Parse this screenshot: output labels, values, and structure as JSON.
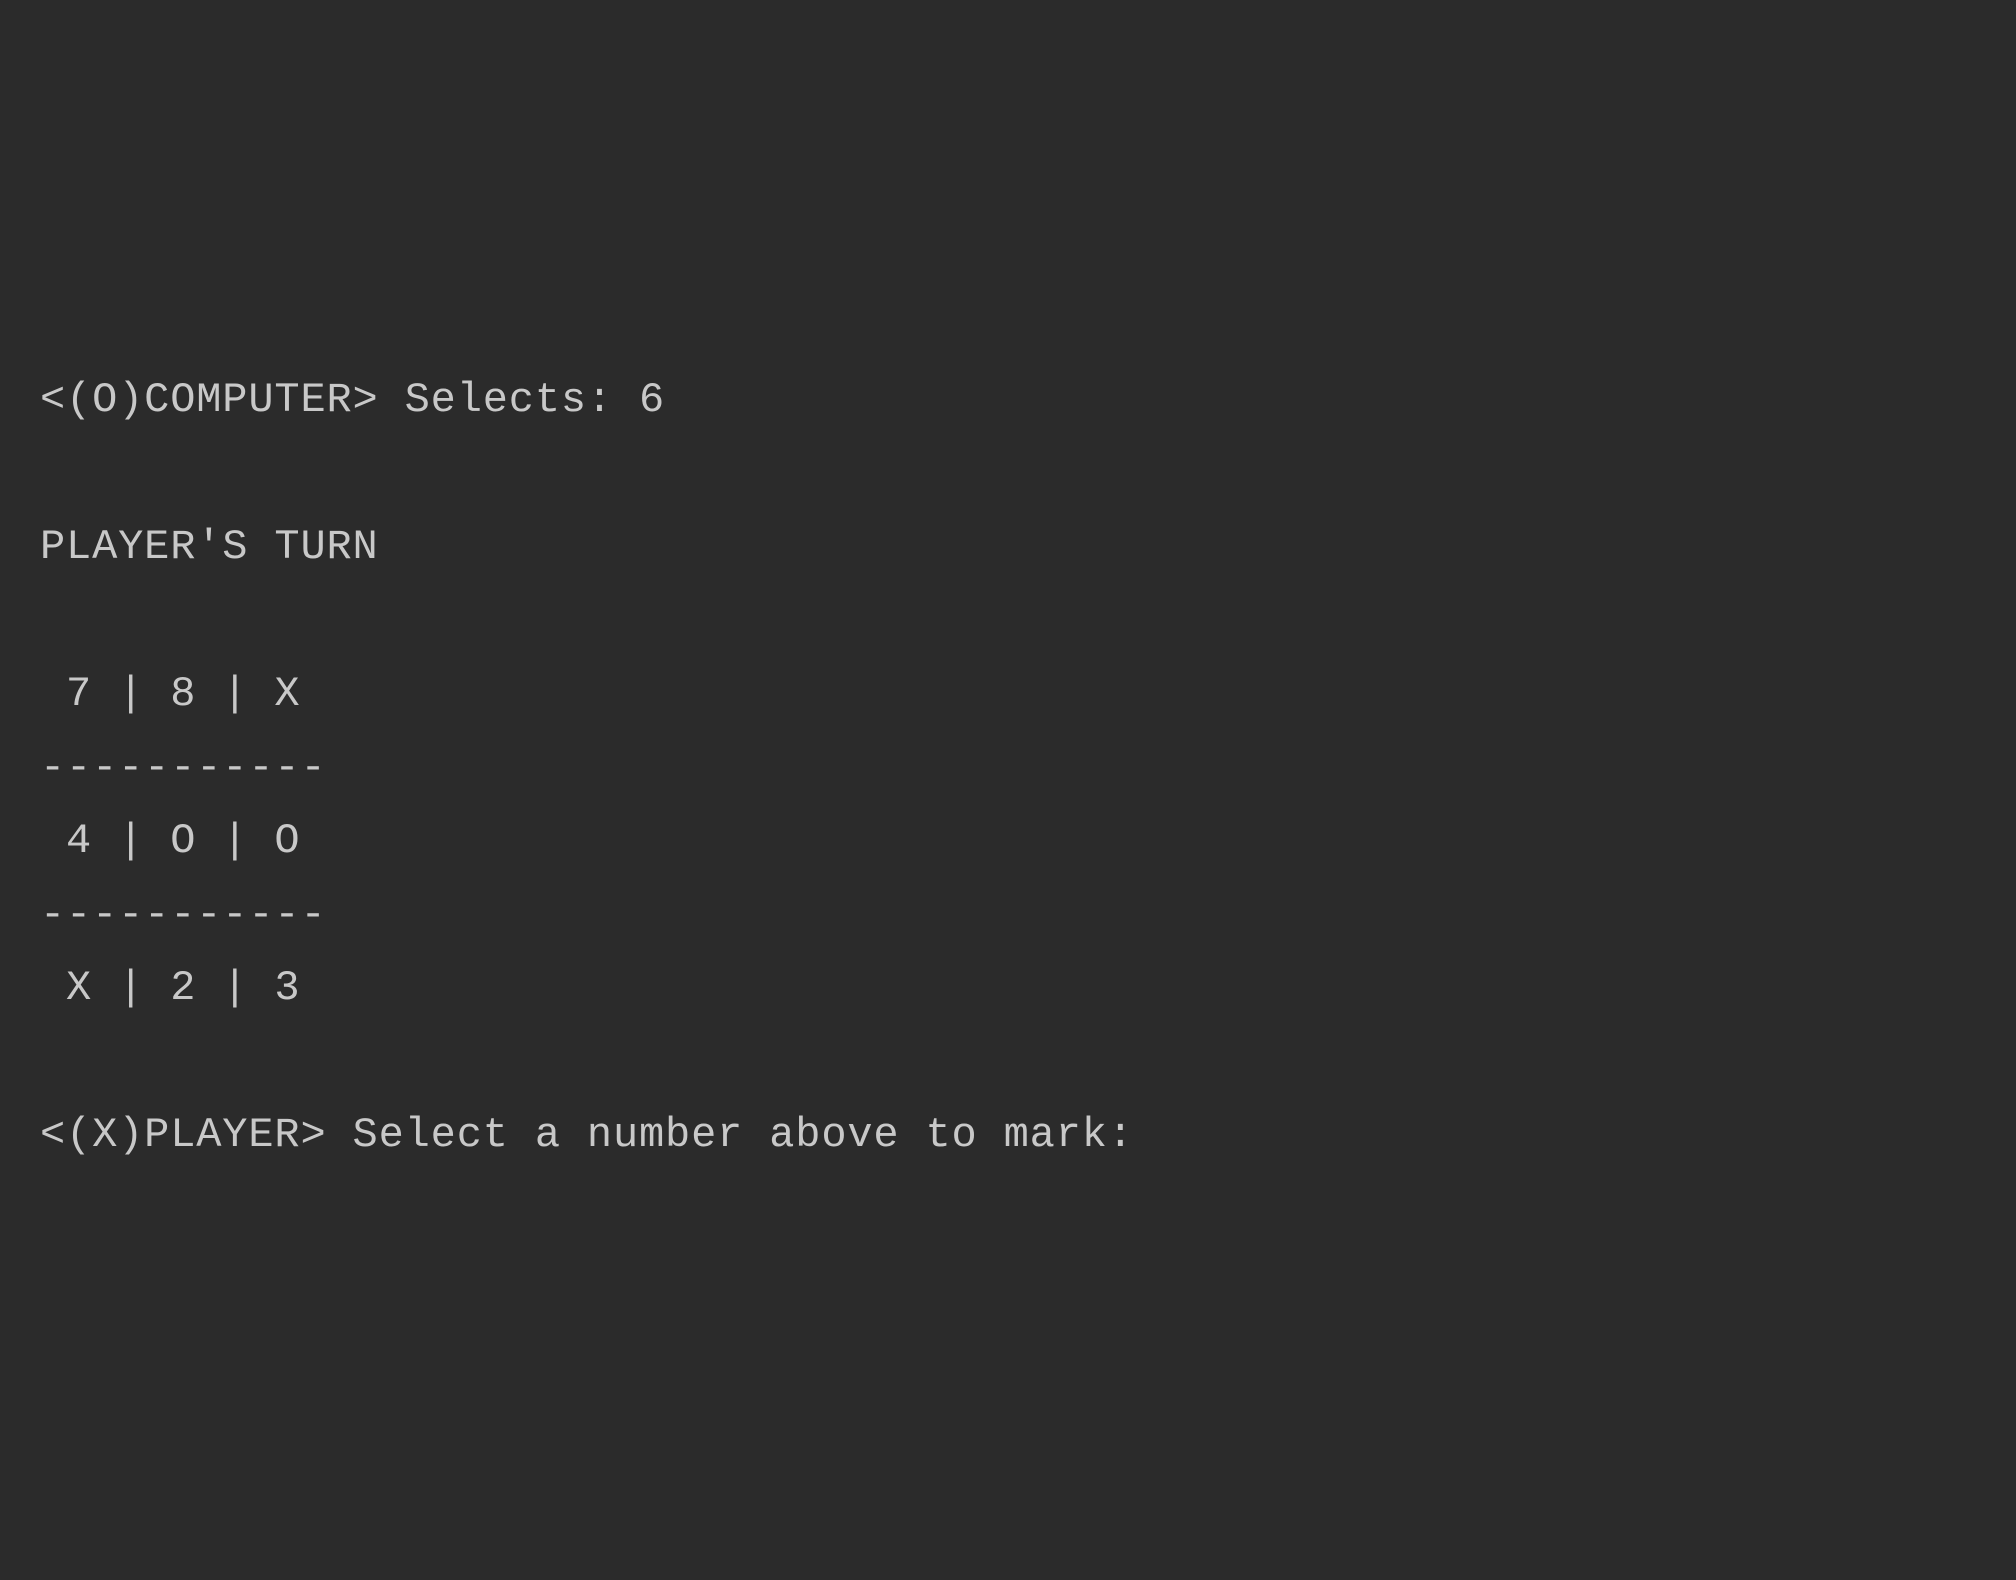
{
  "terminal": {
    "computer_move_line": "<(O)COMPUTER> Selects: 6",
    "turn_header": "PLAYER'S TURN",
    "board_row_top": " 7 | 8 | X",
    "board_divider": "-----------",
    "board_row_middle": " 4 | O | O",
    "board_row_bottom": " X | 2 | 3",
    "prompt_line": "<(X)PLAYER> Select a number above to mark:"
  },
  "game_state": {
    "computer_symbol": "O",
    "player_symbol": "X",
    "computer_last_selection": 6,
    "current_turn": "PLAYER",
    "board": {
      "7": "7",
      "8": "8",
      "9": "X",
      "4": "4",
      "5": "O",
      "6": "O",
      "1": "X",
      "2": "2",
      "3": "3"
    },
    "available_positions": [
      7,
      8,
      4,
      2,
      3
    ]
  }
}
